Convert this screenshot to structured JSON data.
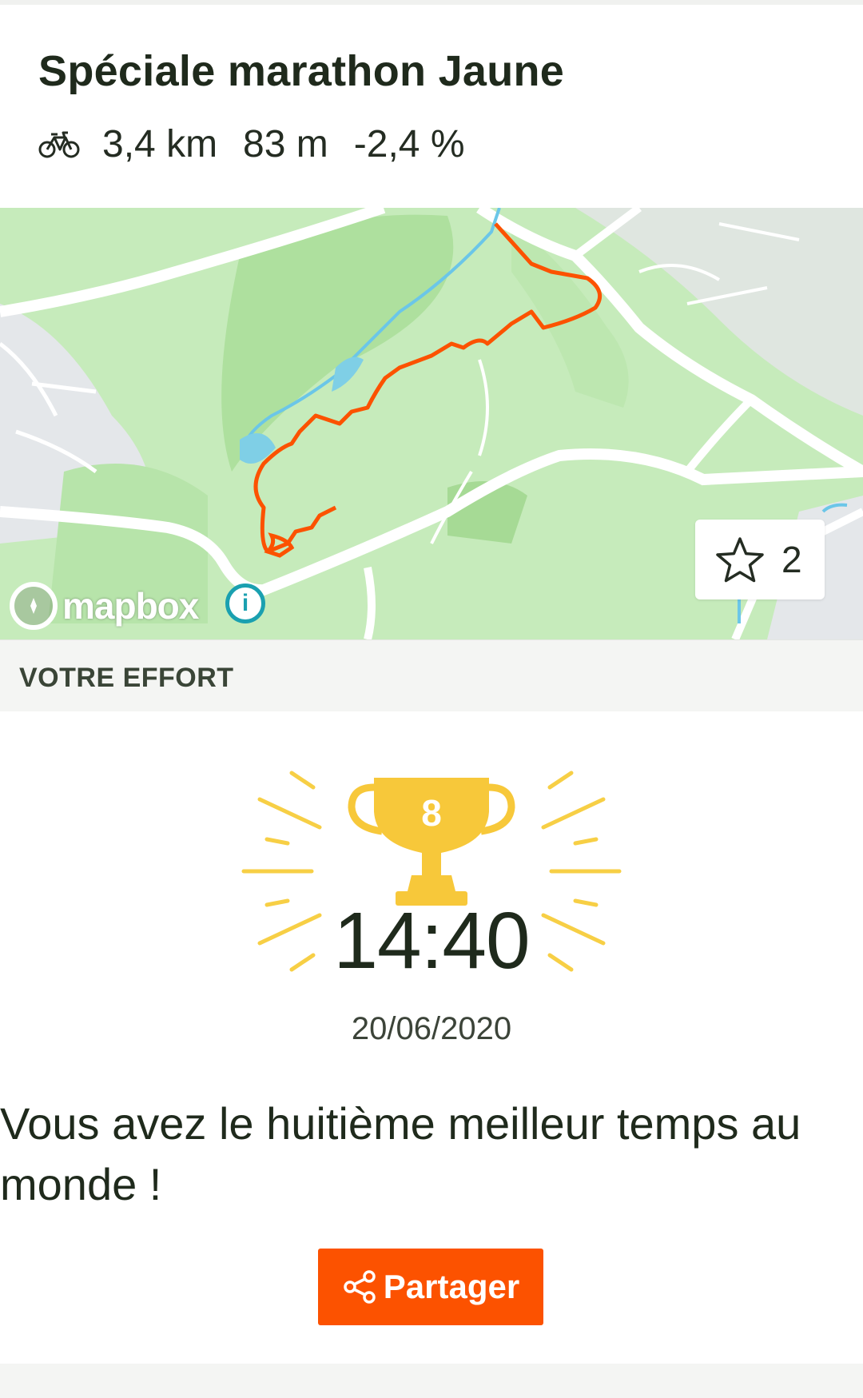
{
  "segment": {
    "title": "Spéciale marathon Jaune",
    "activity_icon": "bike-icon",
    "distance": "3,4 km",
    "elevation": "83 m",
    "grade": "-2,4 %"
  },
  "map": {
    "attribution": "mapbox",
    "info_icon": "info-icon",
    "star_icon": "star-icon",
    "star_count": "2",
    "route_color": "#fc5200"
  },
  "effort": {
    "section_label": "VOTRE EFFORT",
    "rank": "8",
    "trophy_icon": "trophy-icon",
    "time": "14:40",
    "date": "20/06/2020",
    "message": "Vous avez le huitième meilleur temps au monde !"
  },
  "share": {
    "label": "Partager",
    "icon": "share-icon",
    "color": "#fc5200"
  }
}
